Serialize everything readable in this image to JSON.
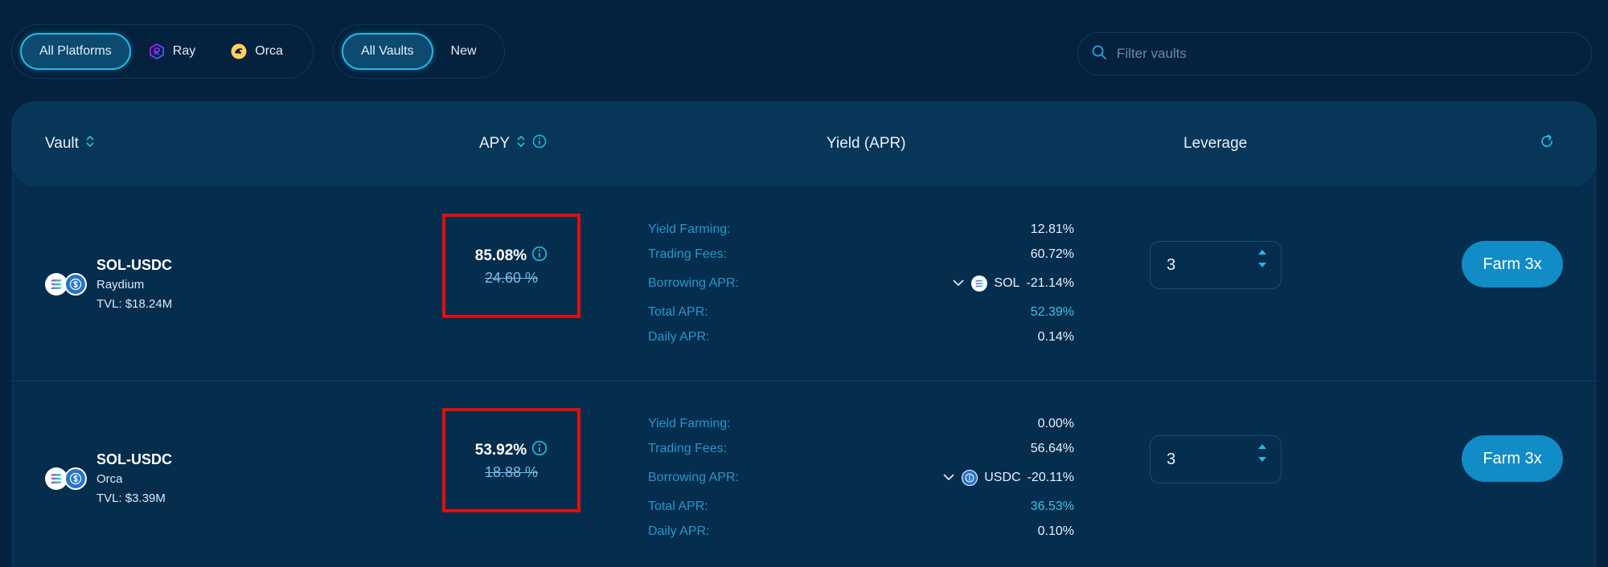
{
  "filters": {
    "platforms": [
      {
        "label": "All Platforms",
        "active": true,
        "icon": ""
      },
      {
        "label": "Ray",
        "active": false,
        "icon": "raydium-icon"
      },
      {
        "label": "Orca",
        "active": false,
        "icon": "orca-icon"
      }
    ],
    "vault_types": [
      {
        "label": "All Vaults",
        "active": true
      },
      {
        "label": "New",
        "active": false
      }
    ],
    "search_placeholder": "Filter vaults"
  },
  "table": {
    "headers": {
      "vault": "Vault",
      "apy": "APY",
      "yield": "Yield (APR)",
      "leverage": "Leverage"
    },
    "labels": {
      "yield_farming": "Yield Farming:",
      "trading_fees": "Trading Fees:",
      "borrowing_apr": "Borrowing APR:",
      "total_apr": "Total APR:",
      "daily_apr": "Daily APR:"
    },
    "rows": [
      {
        "name": "SOL-USDC",
        "platform": "Raydium",
        "tvl": "TVL: $18.24M",
        "apy": "85.08%",
        "apy_old": "24.60 %",
        "yield_farming": "12.81%",
        "trading_fees": "60.72%",
        "borrow_token": "SOL",
        "borrow_value": "-21.14%",
        "total_apr": "52.39%",
        "daily_apr": "0.14%",
        "leverage": "3",
        "farm_label": "Farm 3x"
      },
      {
        "name": "SOL-USDC",
        "platform": "Orca",
        "tvl": "TVL: $3.39M",
        "apy": "53.92%",
        "apy_old": "18.88 %",
        "yield_farming": "0.00%",
        "trading_fees": "56.64%",
        "borrow_token": "USDC",
        "borrow_value": "-20.11%",
        "total_apr": "36.53%",
        "daily_apr": "0.10%",
        "leverage": "3",
        "farm_label": "Farm 3x"
      }
    ]
  },
  "colors": {
    "background": "#04213d",
    "accent": "#27b6e2",
    "highlight_box": "#e10e0e",
    "button": "#118cc6"
  }
}
